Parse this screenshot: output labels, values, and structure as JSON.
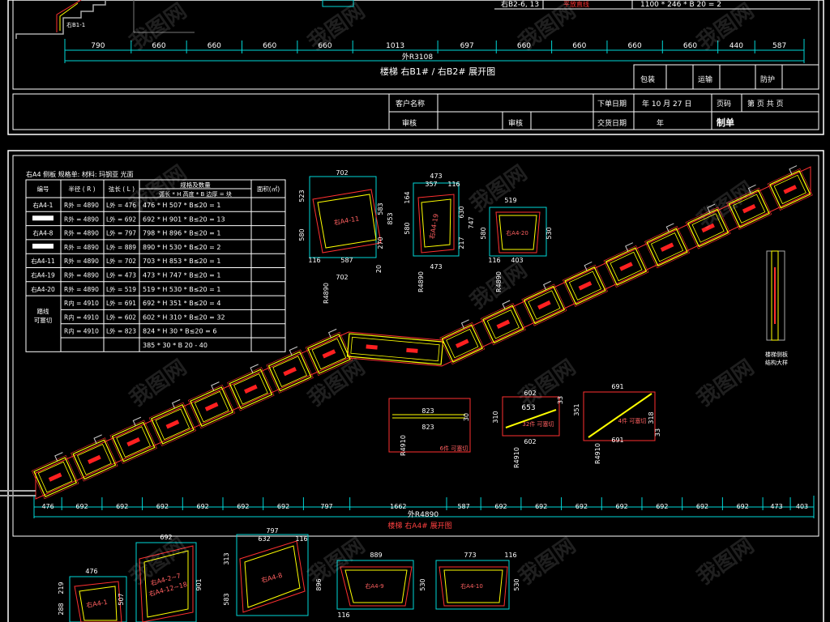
{
  "sheet1": {
    "dims": [
      "790",
      "660",
      "660",
      "660",
      "660",
      "1013",
      "697",
      "660",
      "660",
      "660",
      "660",
      "440",
      "587"
    ],
    "outer_total": "外R3108",
    "piece_label": "右B1-1",
    "top_row": {
      "code": "右B2-6, 13",
      "status": "平放直线",
      "formula": "1100 * 246 * B 20   = 2"
    },
    "title": "楼梯 右B1# / 右B2# 展开图",
    "pack_cells": [
      "包装",
      "运输",
      "防护"
    ],
    "table": {
      "row1": [
        "客户名称",
        "下单日期",
        "年 10 月 27 日",
        "页码",
        "第  页  共  页"
      ],
      "row2": [
        "审核",
        "审核",
        "交货日期",
        "年",
        "制单"
      ]
    }
  },
  "sheet2": {
    "spec": {
      "title": "右A4 侧板 规格单:  材料:  玛钢亚  光面",
      "headers": [
        "编号",
        "半径 ( R )",
        "弦长 ( L )",
        "规格及数量",
        "面积(㎡)"
      ],
      "subheader": "弧长 * H 高度 * B 边厚 =  块",
      "rows": [
        {
          "id": "右A4-1",
          "r": "R外 = 4890",
          "l": "L外 = 476",
          "spec": "476 * H  507 * B≤20 = 1"
        },
        {
          "id": "",
          "r": "R外 = 4890",
          "l": "L外 = 692",
          "spec": "692 * H  901 * B≤20 = 13"
        },
        {
          "id": "右A4-8",
          "r": "R外 = 4890",
          "l": "L外 = 797",
          "spec": "798 * H  896 * B≤20 = 1"
        },
        {
          "id": "",
          "r": "R外 = 4890",
          "l": "L外 = 889",
          "spec": "890 * H  530 * B≤20 = 2"
        },
        {
          "id": "右A4-11",
          "r": "R外 = 4890",
          "l": "L外 = 702",
          "spec": "703 * H  853 * B≤20 = 1"
        },
        {
          "id": "右A4-19",
          "r": "R外 = 4890",
          "l": "L外 = 473",
          "spec": "473 * H  747 * B≤20 = 1"
        },
        {
          "id": "右A4-20",
          "r": "R外 = 4890",
          "l": "L外 = 519",
          "spec": "519 * H  530 * B≤20 = 1"
        },
        {
          "id": "",
          "r": "R内 = 4910",
          "l": "L外 = 691",
          "spec": "692 * H  351 * B≤20 = 4"
        },
        {
          "id": "",
          "r": "R内 = 4910",
          "l": "L外 = 602",
          "spec": "602 * H  310 * B≤20 = 32"
        },
        {
          "id": "",
          "r": "R内 = 4910",
          "l": "L外 = 823",
          "spec": "824 * H   30 * B≤20 = 6"
        },
        {
          "id": "",
          "r": "",
          "l": "",
          "spec": "385 * 30 * B 20 - 40"
        }
      ],
      "merged_note": "踏线\n可塞切"
    },
    "dims": [
      "476",
      "692",
      "692",
      "692",
      "692",
      "692",
      "692",
      "797",
      "1662",
      "587",
      "692",
      "692",
      "692",
      "692",
      "692",
      "692",
      "692",
      "473",
      "403"
    ],
    "outer_total": "外R4890",
    "title": "楼梯  右A4# 展开图",
    "side_note": "楼梯侧板\n结构大样",
    "details": {
      "a11": {
        "w": "702",
        "h1": "523",
        "h2": "583",
        "h3": "853",
        "h4": "580",
        "h5": "270",
        "bw": "587",
        "bl": "116",
        "bb": "702",
        "r": "R4890",
        "label": "右A4-11"
      },
      "a19": {
        "w": "473",
        "w2": "357",
        "w3": "116",
        "h1": "164",
        "h2": "630",
        "h3": "580",
        "h4": "217",
        "h5": "747",
        "bw": "473",
        "r": "R4890",
        "label": "右A4-19"
      },
      "a20": {
        "w": "519",
        "h1": "580",
        "h2": "530",
        "b1": "116",
        "b2": "403",
        "r": "R4890",
        "label": "右A4-20"
      },
      "d823": {
        "w": "823",
        "w2": "823",
        "h": "30",
        "r": "R4910",
        "note": "6件 可塞切"
      },
      "d602": {
        "w": "602",
        "w2": "602",
        "w3": "653",
        "h1": "310",
        "h2": "33",
        "r": "R4910",
        "note": "32件 可塞切"
      },
      "d691": {
        "w": "691",
        "w2": "691",
        "h1": "351",
        "h2": "318",
        "h3": "33",
        "r": "R4910",
        "note": "4件 可塞切"
      },
      "bottom": [
        {
          "w": "476",
          "h1": "288",
          "h2": "219",
          "h3": "507",
          "label": "右A4-1"
        },
        {
          "w": "692",
          "h": "901",
          "label": "右A4-2~7\n右A4-12~18"
        },
        {
          "w": "797",
          "w2": "632",
          "w3": "116",
          "h1": "313",
          "h2": "583",
          "h3": "896",
          "label": "右A4-8"
        },
        {
          "w": "889",
          "h": "530",
          "b": "116",
          "label": "右A4-9"
        },
        {
          "w": "773",
          "h": "530",
          "b": "116",
          "label": "右A4-10"
        }
      ]
    }
  },
  "watermark": "我图网",
  "colors": {
    "bg": "#000000",
    "frame": "#ffffff",
    "dim": "#00d7d7",
    "cyan": "#00ffff",
    "yellow": "#ffff00",
    "red": "#ff0000",
    "green": "#00ff00",
    "magenta": "#ff00ff"
  }
}
